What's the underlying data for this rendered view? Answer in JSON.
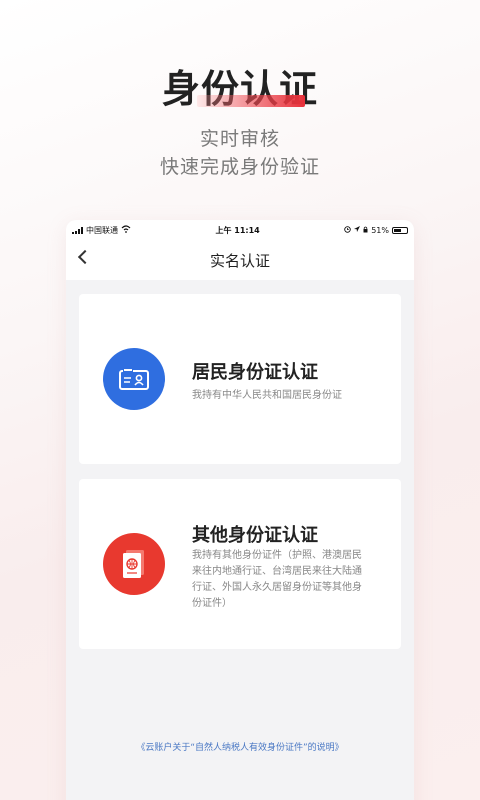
{
  "promo": {
    "title": "身份认证",
    "subtitle_line1": "实时审核",
    "subtitle_line2": "快速完成身份验证"
  },
  "status_bar": {
    "carrier": "中国联通",
    "time": "上午 11:14",
    "battery": "51%"
  },
  "nav": {
    "title": "实名认证"
  },
  "cards": [
    {
      "title": "居民身份证认证",
      "description": "我持有中华人民共和国居民身份证",
      "icon": "id-card-icon",
      "icon_color": "#2f6ee0"
    },
    {
      "title": "其他身份证认证",
      "description": "我持有其他身份证件（护照、港澳居民来往内地通行证、台湾居民来往大陆通行证、外国人永久居留身份证等其他身份证件）",
      "icon": "passport-icon",
      "icon_color": "#e8392f"
    }
  ],
  "footer": {
    "link": "《云账户关于“自然人纳税人有效身份证件”的说明》"
  }
}
